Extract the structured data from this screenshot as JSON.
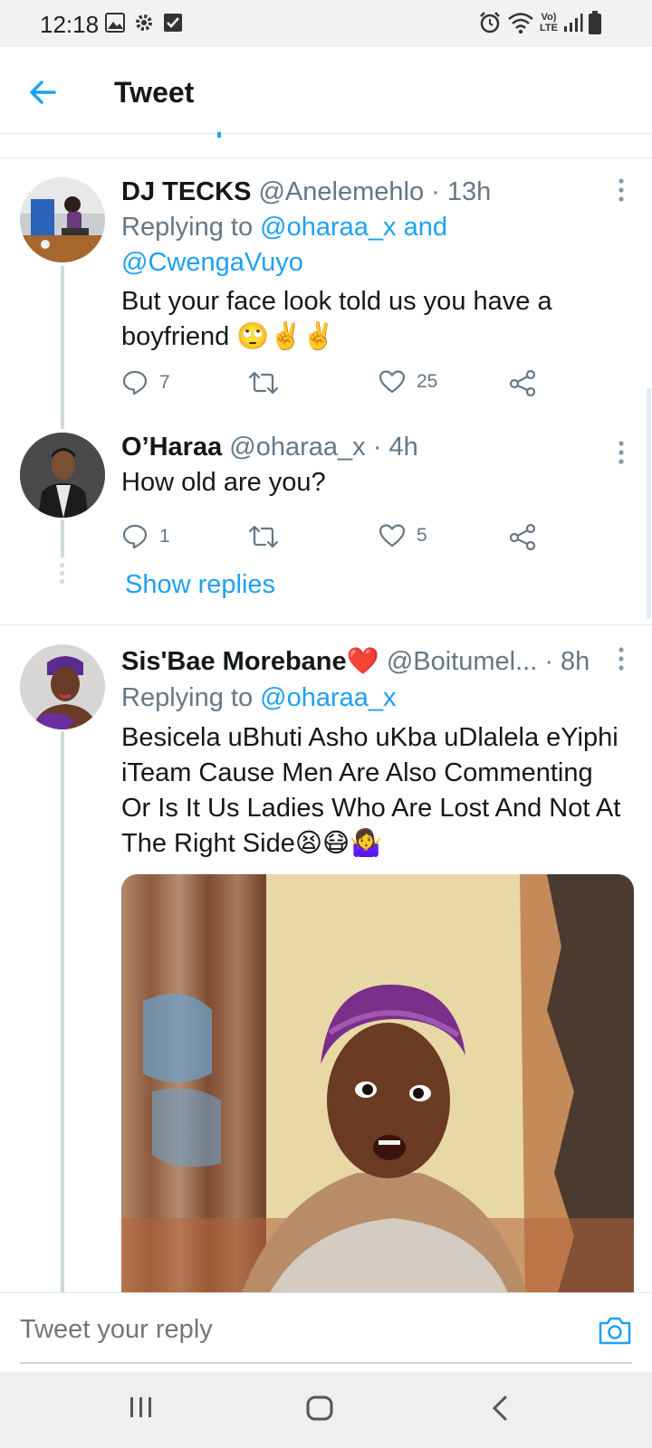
{
  "status_bar": {
    "time": "12:18",
    "icons_left": [
      "gallery-icon",
      "gear-icon",
      "checkbox-icon"
    ],
    "icons_right": [
      "alarm-icon",
      "wifi-icon",
      "volte-icon",
      "signal-icon",
      "battery-icon"
    ],
    "volte_label": "Vo) LTE"
  },
  "header": {
    "title": "Tweet",
    "back_icon": "arrow-left-icon"
  },
  "tweets": [
    {
      "name": "DJ TECKS",
      "handle": "@Anelemehlo",
      "time": "· 13h",
      "replying_prefix": "Replying to ",
      "replying_mentions": "@oharaa_x and @CwengaVuyo",
      "text": "But your face look told us you have a boyfriend 🙄✌️✌️",
      "replies": "7",
      "retweets": "",
      "likes": "25"
    },
    {
      "name": "O’Haraa",
      "handle": "@oharaa_x",
      "time": "· 4h",
      "text": "How old are you?",
      "replies": "1",
      "retweets": "",
      "likes": "5"
    },
    {
      "name": "Sis'Bae Morebane❤️",
      "handle": "@Boitumel...",
      "time": "· 8h",
      "replying_prefix": "Replying to ",
      "replying_mentions": "@oharaa_x",
      "text": "Besicela uBhuti Asho uKba uDlalela eYiphi iTeam Cause Men Are Also Commenting Or Is It Us Ladies Who Are Lost And Not At The Right Side😫😷🤷‍♀️"
    }
  ],
  "show_replies_label": "Show replies",
  "reply_bar": {
    "placeholder": "Tweet your reply",
    "camera_icon": "camera-icon"
  },
  "colors": {
    "accent": "#1da1f2",
    "muted": "#657786",
    "text": "#14171a"
  }
}
